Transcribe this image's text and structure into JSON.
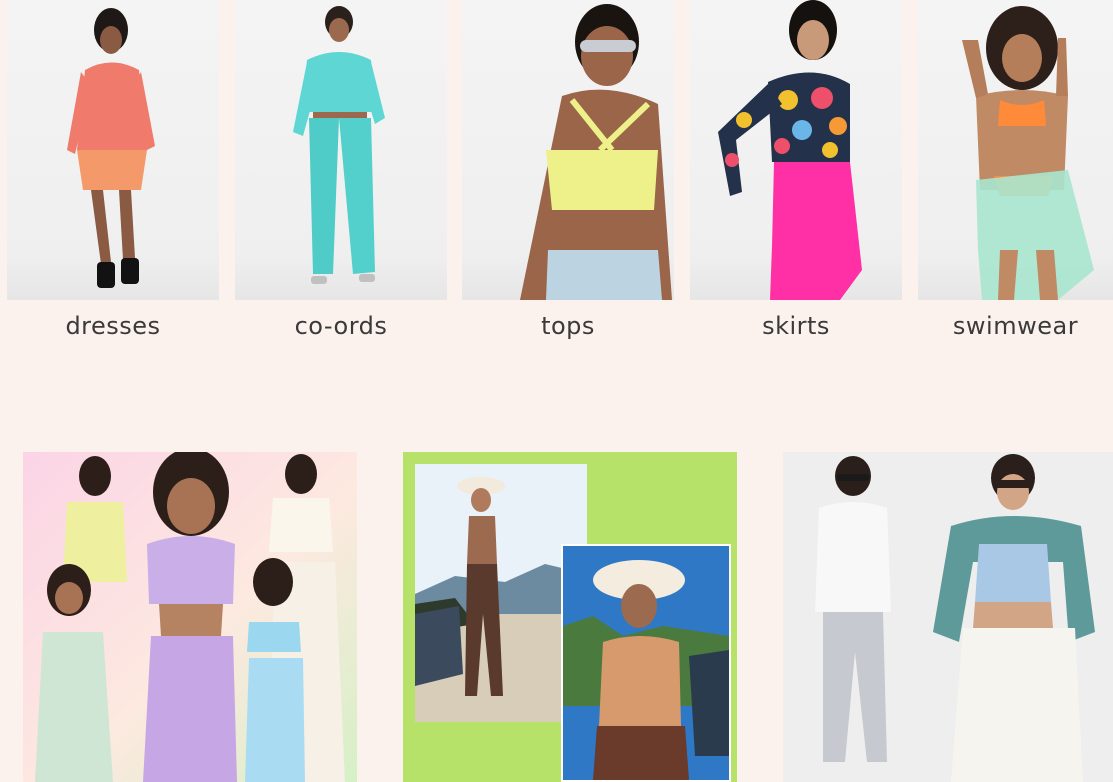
{
  "categories": [
    {
      "label": "dresses"
    },
    {
      "label": "co-ords"
    },
    {
      "label": "tops"
    },
    {
      "label": "skirts"
    },
    {
      "label": "swimwear"
    }
  ],
  "colors": {
    "page_bg": "#fbf2ee",
    "promo_green": "#b6e26a",
    "dress_pink": "#f07a6c",
    "coord_aqua": "#5ed6d3",
    "top_yellow": "#eef08a",
    "skirt_pink": "#ff2fa6",
    "bikini_orange": "#ff8a3a"
  }
}
